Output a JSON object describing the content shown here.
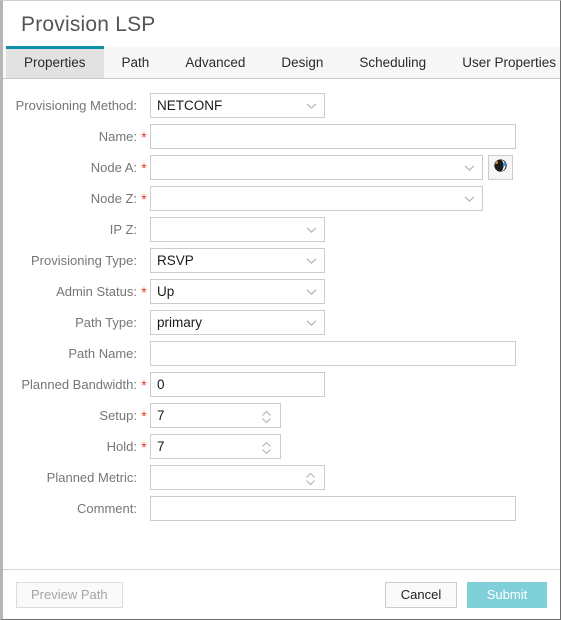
{
  "window": {
    "title": "Provision LSP"
  },
  "tabs": [
    {
      "label": "Properties",
      "active": true
    },
    {
      "label": "Path",
      "active": false
    },
    {
      "label": "Advanced",
      "active": false
    },
    {
      "label": "Design",
      "active": false
    },
    {
      "label": "Scheduling",
      "active": false
    },
    {
      "label": "User Properties",
      "active": false
    }
  ],
  "form": {
    "fields": [
      {
        "label": "Provisioning Method:",
        "required": false,
        "value": "NETCONF",
        "type": "select"
      },
      {
        "label": "Name:",
        "required": true,
        "value": "",
        "type": "text"
      },
      {
        "label": "Node A:",
        "required": true,
        "value": "",
        "type": "select",
        "button": "globe-icon"
      },
      {
        "label": "Node Z:",
        "required": true,
        "value": "",
        "type": "select"
      },
      {
        "label": "IP Z:",
        "required": false,
        "value": "",
        "type": "select"
      },
      {
        "label": "Provisioning Type:",
        "required": false,
        "value": "RSVP",
        "type": "select"
      },
      {
        "label": "Admin Status:",
        "required": true,
        "value": "Up",
        "type": "select"
      },
      {
        "label": "Path Type:",
        "required": false,
        "value": "primary",
        "type": "select"
      },
      {
        "label": "Path Name:",
        "required": false,
        "value": "",
        "type": "text"
      },
      {
        "label": "Planned Bandwidth:",
        "required": true,
        "value": "0",
        "type": "text"
      },
      {
        "label": "Setup:",
        "required": true,
        "value": "7",
        "type": "spinner"
      },
      {
        "label": "Hold:",
        "required": true,
        "value": "7",
        "type": "spinner"
      },
      {
        "label": "Planned Metric:",
        "required": false,
        "value": "",
        "type": "spinner"
      },
      {
        "label": "Comment:",
        "required": false,
        "value": "",
        "type": "text"
      }
    ]
  },
  "footer": {
    "preview_label": "Preview Path",
    "cancel_label": "Cancel",
    "submit_label": "Submit"
  },
  "colors": {
    "accent_tab": "#0c91a4",
    "submit_bg": "#80d0da",
    "required_star": "#e8322b",
    "label_text": "#767676"
  }
}
